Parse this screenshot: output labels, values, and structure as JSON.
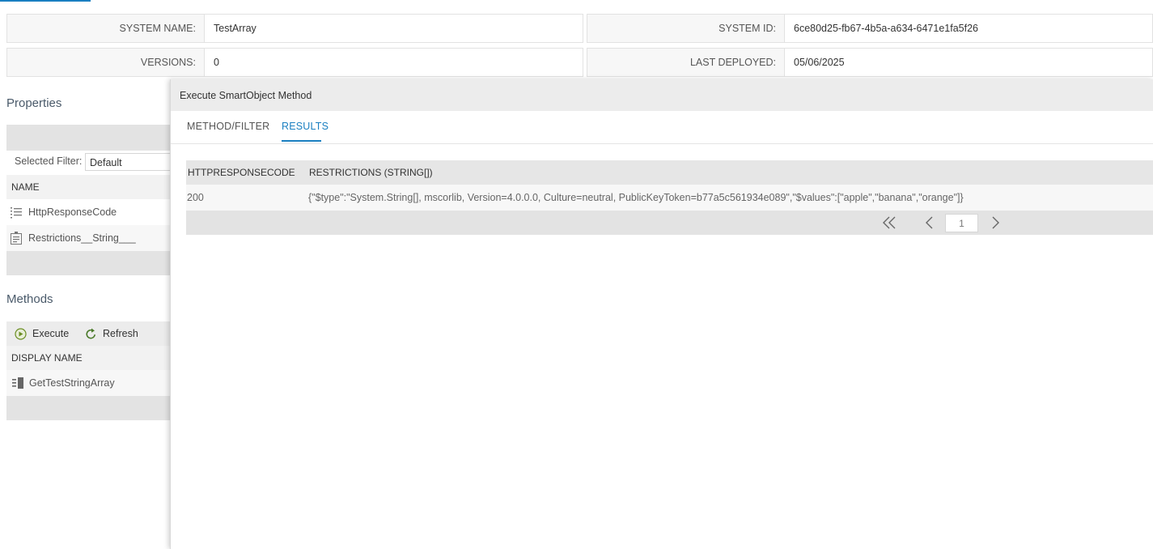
{
  "info": {
    "system_name_label": "SYSTEM NAME:",
    "system_name_value": "TestArray",
    "system_id_label": "SYSTEM ID:",
    "system_id_value": "6ce80d25-fb67-4b5a-a634-6471e1fa5f26",
    "versions_label": "VERSIONS:",
    "versions_value": "0",
    "last_deployed_label": "LAST DEPLOYED:",
    "last_deployed_value": "05/06/2025"
  },
  "properties": {
    "title": "Properties",
    "filter_label": "Selected Filter:",
    "filter_value": "Default",
    "column_header": "NAME",
    "items": [
      {
        "label": "HttpResponseCode",
        "icon": "list-field-icon"
      },
      {
        "label": "Restrictions__String___",
        "icon": "memo-field-icon"
      }
    ]
  },
  "methods": {
    "title": "Methods",
    "execute_label": "Execute",
    "refresh_label": "Refresh",
    "column_header": "DISPLAY NAME",
    "items": [
      {
        "label": "GetTestStringArray",
        "icon": "method-icon"
      }
    ]
  },
  "dialog": {
    "title": "Execute SmartObject Method",
    "tabs": [
      {
        "label": "METHOD/FILTER",
        "active": false
      },
      {
        "label": "RESULTS",
        "active": true
      }
    ],
    "grid": {
      "columns": [
        "HTTPRESPONSECODE",
        "RESTRICTIONS (STRING[])"
      ],
      "rows": [
        [
          "200",
          "{\"$type\":\"System.String[], mscorlib, Version=4.0.0.0, Culture=neutral, PublicKeyToken=b77a5c561934e089\",\"$values\":[\"apple\",\"banana\",\"orange\"]}"
        ]
      ]
    },
    "pager": {
      "current_page": "1"
    }
  },
  "colors": {
    "accent": "#1a7fc1",
    "execute_icon": "#6b8e23",
    "refresh_icon": "#4a7a2a"
  }
}
